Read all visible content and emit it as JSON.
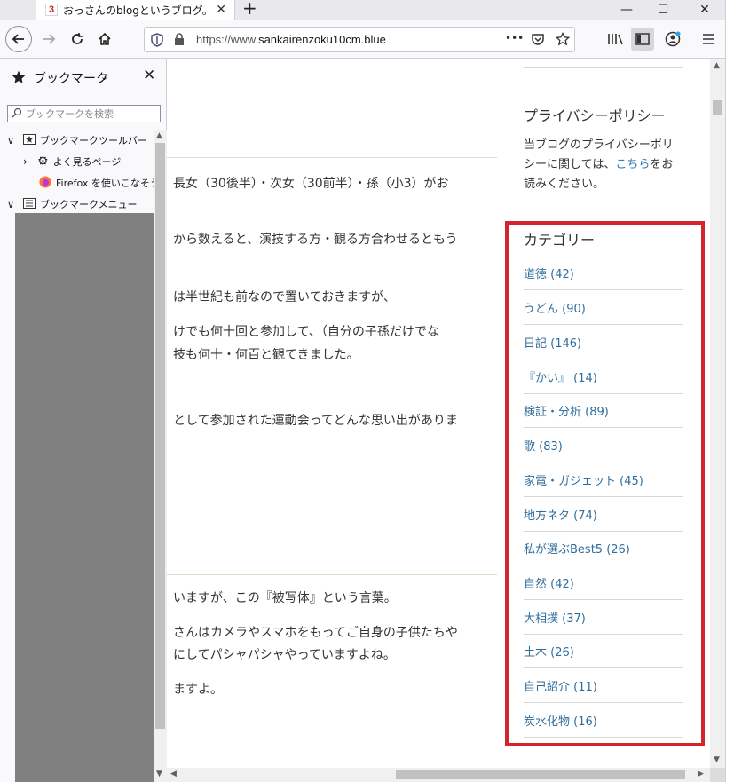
{
  "browser": {
    "tab_title": "おっさんのblogというブログ。",
    "tab_favicon_text": "3",
    "url_prefix": "https://www.",
    "url_domain": "sankairenzoku10cm.blue",
    "page_actions": "•••"
  },
  "sidebar": {
    "title": "ブックマーク",
    "search_placeholder": "ブックマークを検索",
    "tree": [
      {
        "label": "ブックマークツールバー",
        "icon": "bookmark-star-folder-icon",
        "state": "expanded"
      },
      {
        "label": "よく見るページ",
        "icon": "gear-icon",
        "state": "collapsed"
      },
      {
        "label": "Firefox を使いこなそう",
        "icon": "firefox-icon",
        "state": "leaf"
      },
      {
        "label": "ブックマークメニュー",
        "icon": "menu-folder-icon",
        "state": "expanded"
      }
    ]
  },
  "article": {
    "lines": [
      "長女（30後半）・次女（30前半）・孫（小3）がお",
      "から数えると、演技する方・観る方合わせるともう",
      "は半世紀も前なので置いておきますが、",
      "けでも何十回と参加して、（自分の子孫だけでな",
      "技も何十・何百と観てきました。",
      "として参加された運動会ってどんな思い出がありま",
      "いますが、この『被写体』という言葉。",
      "さんはカメラやスマホをもってご自身の子供たちや",
      "にしてパシャパシャやっていますよね。",
      "ますよ。"
    ]
  },
  "widgets": {
    "privacy_title": "プライバシーポリシー",
    "privacy_text_before": "当ブログのプライバシーポリシーに関しては、",
    "privacy_link": "こちら",
    "privacy_text_after": "をお読みください。",
    "category_title": "カテゴリー",
    "categories": [
      "道徳 (42)",
      "うどん (90)",
      "日記 (146)",
      "『かい』 (14)",
      "検証・分析 (89)",
      "歌 (83)",
      "家電・ガジェット (45)",
      "地方ネタ (74)",
      "私が選ぶBest5 (26)",
      "自然 (42)",
      "大相撲 (37)",
      "土木 (26)",
      "自己紹介 (11)",
      "炭水化物 (16)"
    ],
    "highlight_color": "#d4252d",
    "link_color": "#2f6d9c"
  }
}
